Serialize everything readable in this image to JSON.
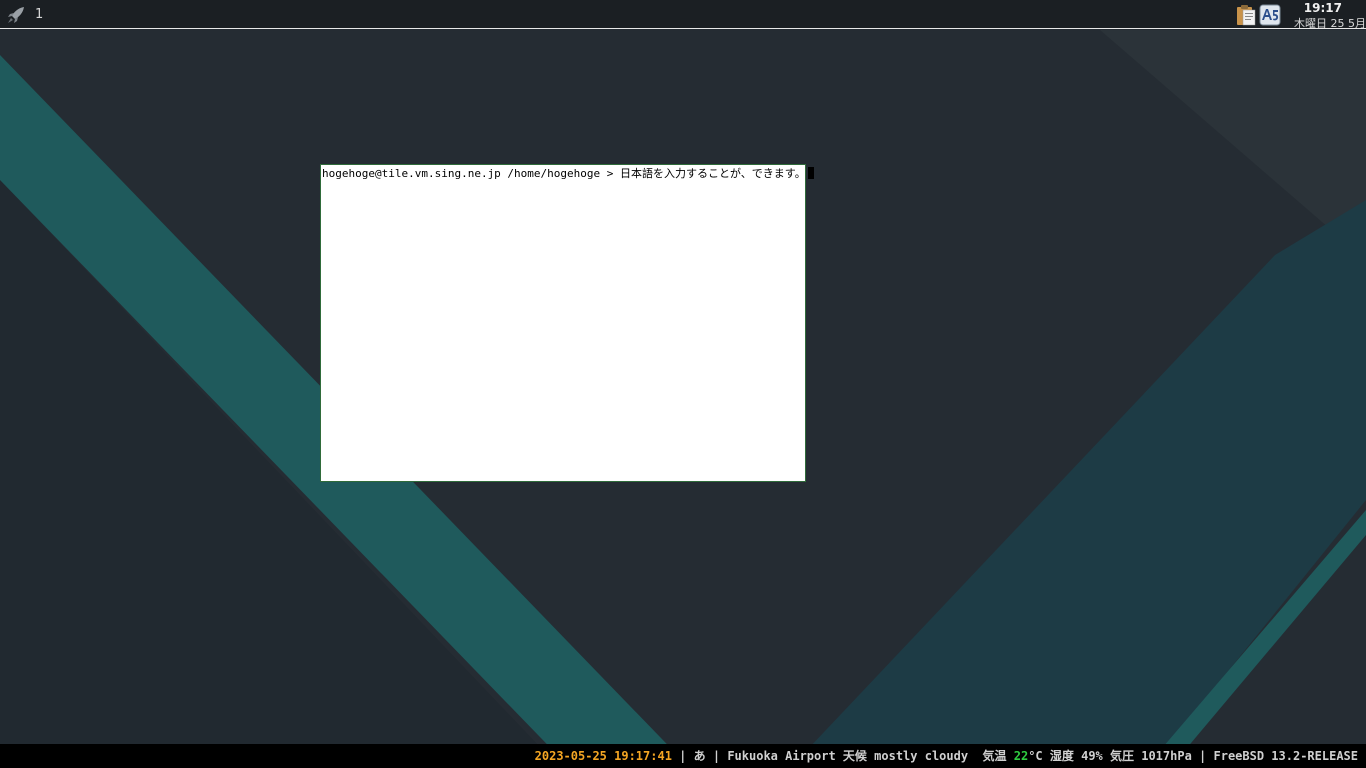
{
  "top_panel": {
    "workspace": "1",
    "clock_time": "19:17",
    "clock_date": "木曜日 25 5月"
  },
  "terminal": {
    "prompt": "hogehoge@tile.vm.sing.ne.jp /home/hogehoge > ",
    "input": "日本語を入力することが、できます。"
  },
  "status_bar": {
    "datetime": "2023-05-25 19:17:41",
    "sep1": " | ",
    "ime": "あ",
    "sep2": " | ",
    "weather_prefix": "Fukuoka Airport 天候 mostly cloudy  気温 ",
    "temperature": "22",
    "weather_suffix": "°C 湿度 49% 気圧 1017hPa",
    "sep3": " | ",
    "os": "FreeBSD 13.2-RELEASE"
  },
  "colors": {
    "wallpaper_dark": "#252c33",
    "wallpaper_teal": "#1f5a5c",
    "datetime_accent": "#f5a623",
    "temperature_accent": "#2ecc40"
  },
  "icons": [
    "launcher-rocket-icon",
    "clipboard-icon",
    "ime-input-method-icon"
  ]
}
